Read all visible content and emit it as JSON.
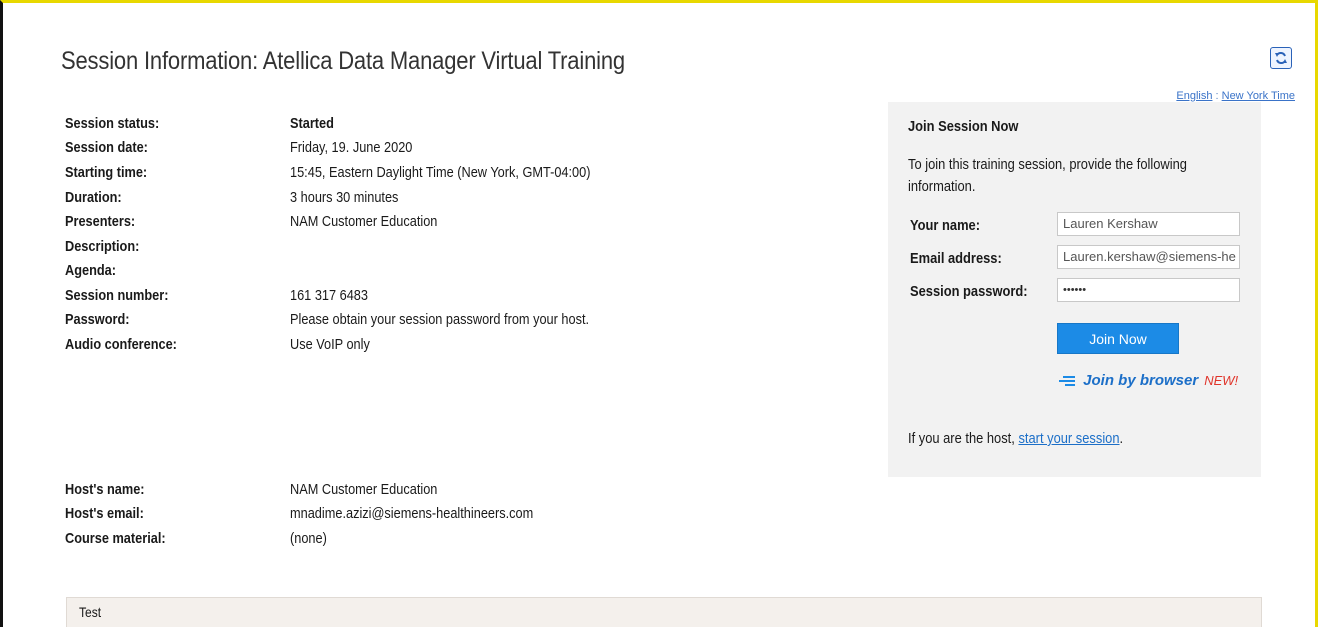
{
  "page": {
    "title": "Session Information: Atellica Data Manager Virtual Training",
    "language_link": "English",
    "separator": " : ",
    "timezone_link": "New York Time"
  },
  "icons": {
    "refresh": "refresh-icon"
  },
  "session_info": [
    {
      "label": "Session status:",
      "value": "Started"
    },
    {
      "label": "Session date:",
      "value": "Friday, 19. June 2020"
    },
    {
      "label": "Starting time:",
      "value": "15:45, Eastern Daylight Time (New York, GMT-04:00)"
    },
    {
      "label": "Duration:",
      "value": "3 hours 30 minutes"
    },
    {
      "label": "Presenters:",
      "value": "NAM Customer Education"
    },
    {
      "label": "Description:",
      "value": ""
    },
    {
      "label": "Agenda:",
      "value": ""
    },
    {
      "label": "Session number:",
      "value": "161 317 6483"
    },
    {
      "label": "Password:",
      "value": "Please obtain your session password from your host."
    },
    {
      "label": "Audio conference:",
      "value": "Use VoIP only"
    }
  ],
  "host_info": [
    {
      "label": "Host's name:",
      "value": "NAM Customer Education"
    },
    {
      "label": "Host's email:",
      "value": "mnadime.azizi@siemens-healthineers.com"
    },
    {
      "label": "Course material:",
      "value": "(none)"
    }
  ],
  "join_panel": {
    "title": "Join Session Now",
    "description": "To join this training session, provide the following information.",
    "name_label": "Your name:",
    "name_value": "Lauren Kershaw",
    "email_label": "Email address:",
    "email_value": "Lauren.kershaw@siemens-he",
    "password_label": "Session password:",
    "password_value": "••••••",
    "join_button": "Join Now",
    "browser_link": "Join by browser",
    "browser_new": "NEW!",
    "host_prefix": "If you are the host, ",
    "host_link": "start your session",
    "host_suffix": "."
  },
  "test_section": {
    "label": "Test"
  },
  "colors": {
    "accent": "#1c8be6",
    "link": "#1c6fc8",
    "new_badge": "#e0352b",
    "panel_bg": "#f2f2f2"
  }
}
